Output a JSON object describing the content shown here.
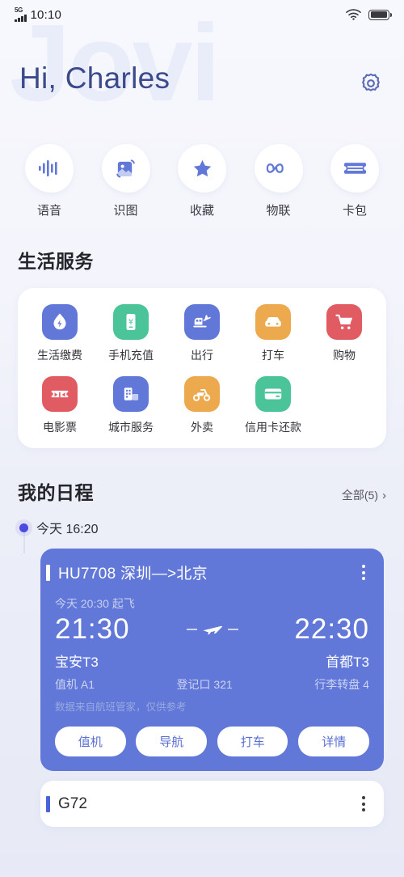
{
  "status_bar": {
    "network_type": "5G",
    "time": "10:10",
    "wifi_icon": "wifi-icon",
    "battery_icon": "battery-full-icon"
  },
  "header": {
    "watermark": "Jovi",
    "greeting": "Hi, Charles",
    "settings_icon": "gear-icon"
  },
  "quick_actions": [
    {
      "label": "语音",
      "icon": "voice-waveform-icon"
    },
    {
      "label": "识图",
      "icon": "image-recognition-icon"
    },
    {
      "label": "收藏",
      "icon": "star-icon"
    },
    {
      "label": "物联",
      "icon": "infinity-iot-icon"
    },
    {
      "label": "卡包",
      "icon": "card-wallet-icon"
    }
  ],
  "life_services": {
    "title": "生活服务",
    "rows": [
      [
        {
          "label": "生活缴费",
          "icon": "water-drop-bolt-icon",
          "color": "#6278d8"
        },
        {
          "label": "手机充值",
          "icon": "phone-yuan-icon",
          "color": "#4cc49a"
        },
        {
          "label": "出行",
          "icon": "train-plane-icon",
          "color": "#6278d8"
        },
        {
          "label": "打车",
          "icon": "car-icon",
          "color": "#eda94e"
        },
        {
          "label": "购物",
          "icon": "shopping-cart-icon",
          "color": "#e05c62"
        }
      ],
      [
        {
          "label": "电影票",
          "icon": "movie-ticket-icon",
          "color": "#e05c62"
        },
        {
          "label": "城市服务",
          "icon": "city-building-icon",
          "color": "#6278d8"
        },
        {
          "label": "外卖",
          "icon": "scooter-delivery-icon",
          "color": "#eda94e"
        },
        {
          "label": "信用卡还款",
          "icon": "credit-card-icon",
          "color": "#4cc49a"
        }
      ]
    ]
  },
  "schedule": {
    "title": "我的日程",
    "all_link": "全部(5)",
    "chevron_icon": "chevron-right-icon",
    "timeline_label": "今天 16:20",
    "flight": {
      "title": "HU7708 深圳—>北京",
      "menu_icon": "kebab-menu-icon",
      "subtitle": "今天 20:30 起飞",
      "depart_time": "21:30",
      "arrive_time": "22:30",
      "plane_icon": "airplane-icon",
      "depart_terminal": "宝安T3",
      "arrive_terminal": "首都T3",
      "checkin": "值机 A1",
      "gate": "登记口 321",
      "baggage": "行李转盘 4",
      "note": "数据来自航班管家，仅供参考",
      "buttons": [
        "值机",
        "导航",
        "打车",
        "详情"
      ]
    },
    "train": {
      "title": "G72",
      "menu_icon": "kebab-menu-icon"
    }
  }
}
